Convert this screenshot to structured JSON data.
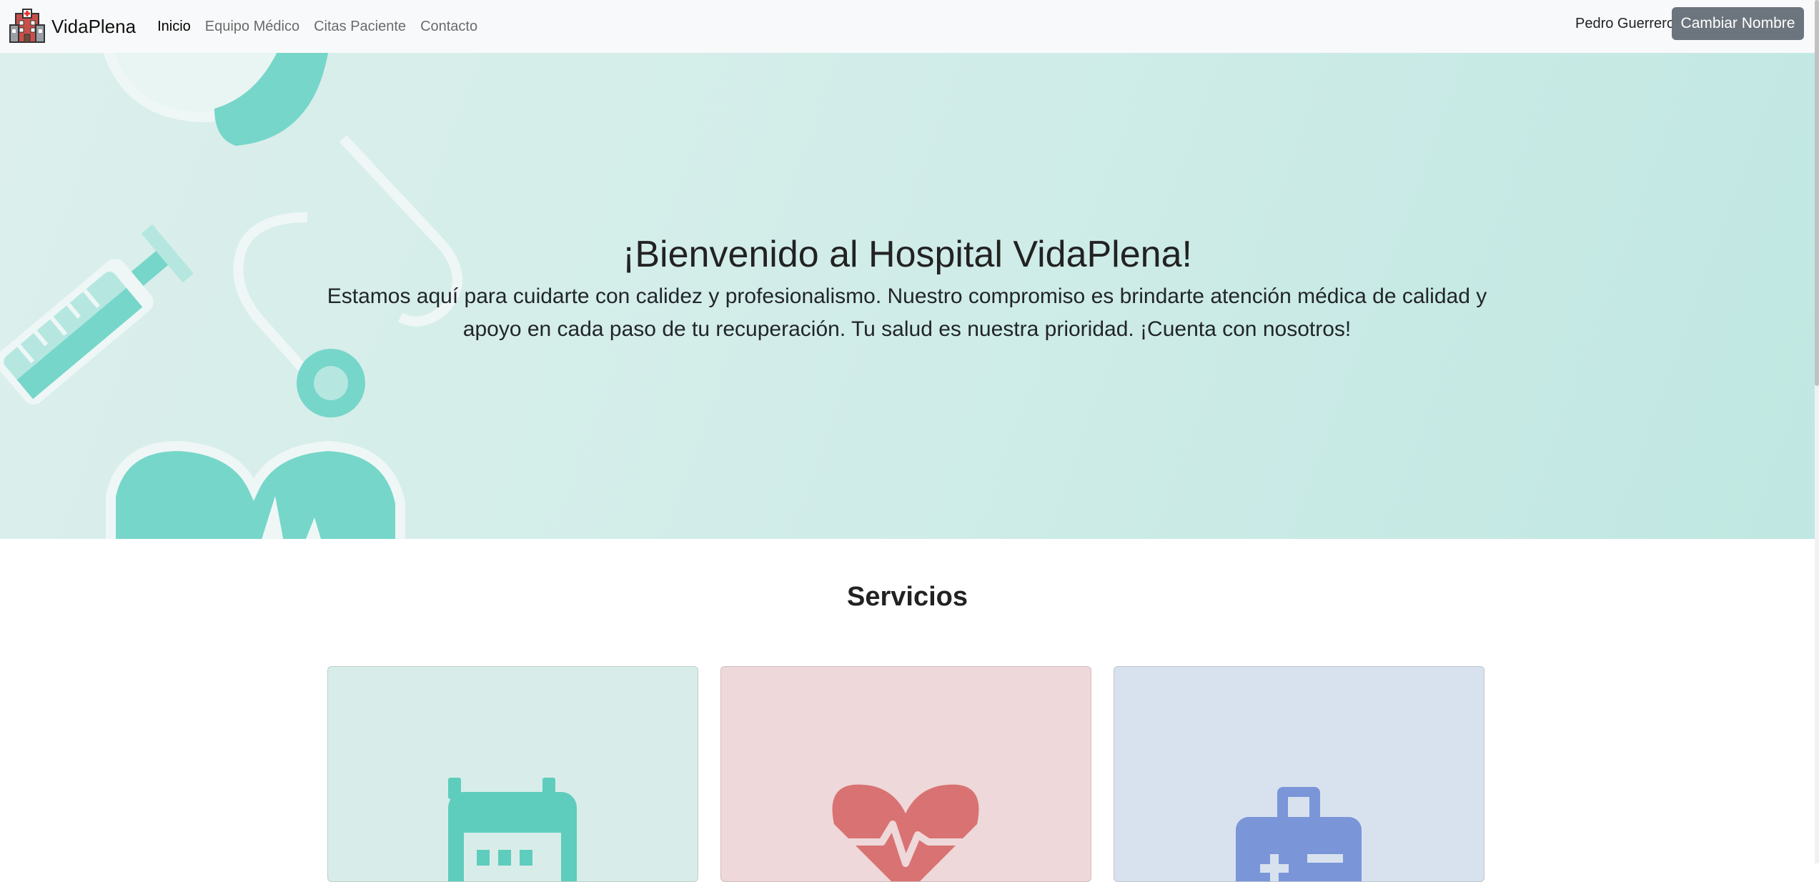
{
  "navbar": {
    "brand": "VidaPlena",
    "brand_icon": "hospital-building-icon",
    "links": [
      {
        "label": "Inicio",
        "active": true
      },
      {
        "label": "Equipo Médico",
        "active": false
      },
      {
        "label": "Citas Paciente",
        "active": false
      },
      {
        "label": "Contacto",
        "active": false
      }
    ],
    "user_name": "Pedro Guerrero",
    "change_button": "Cambiar Nombre"
  },
  "hero": {
    "title": "¡Bienvenido al Hospital VidaPlena!",
    "text": "Estamos aquí para cuidarte con calidez y profesionalismo. Nuestro compromiso es brindarte atención médica de calidad y apoyo en cada paso de tu recuperación. Tu salud es nuestra prioridad. ¡Cuenta con nosotros!",
    "background_icons": [
      "stethoscope-icon",
      "syringe-icon",
      "heart-icon"
    ]
  },
  "services": {
    "title": "Servicios",
    "cards": [
      {
        "icon": "calendar-icon",
        "bg": "#d8ede9",
        "accent": "#5ecdbd"
      },
      {
        "icon": "heartbeat-icon",
        "bg": "#eed8d9",
        "accent": "#d97272"
      },
      {
        "icon": "medical-kit-icon",
        "bg": "#d8e2ee",
        "accent": "#7a95d8"
      }
    ]
  },
  "colors": {
    "navbar_bg": "#f8f9fa",
    "button_bg": "#6c757d",
    "hero_accent": "#76d6c9"
  }
}
